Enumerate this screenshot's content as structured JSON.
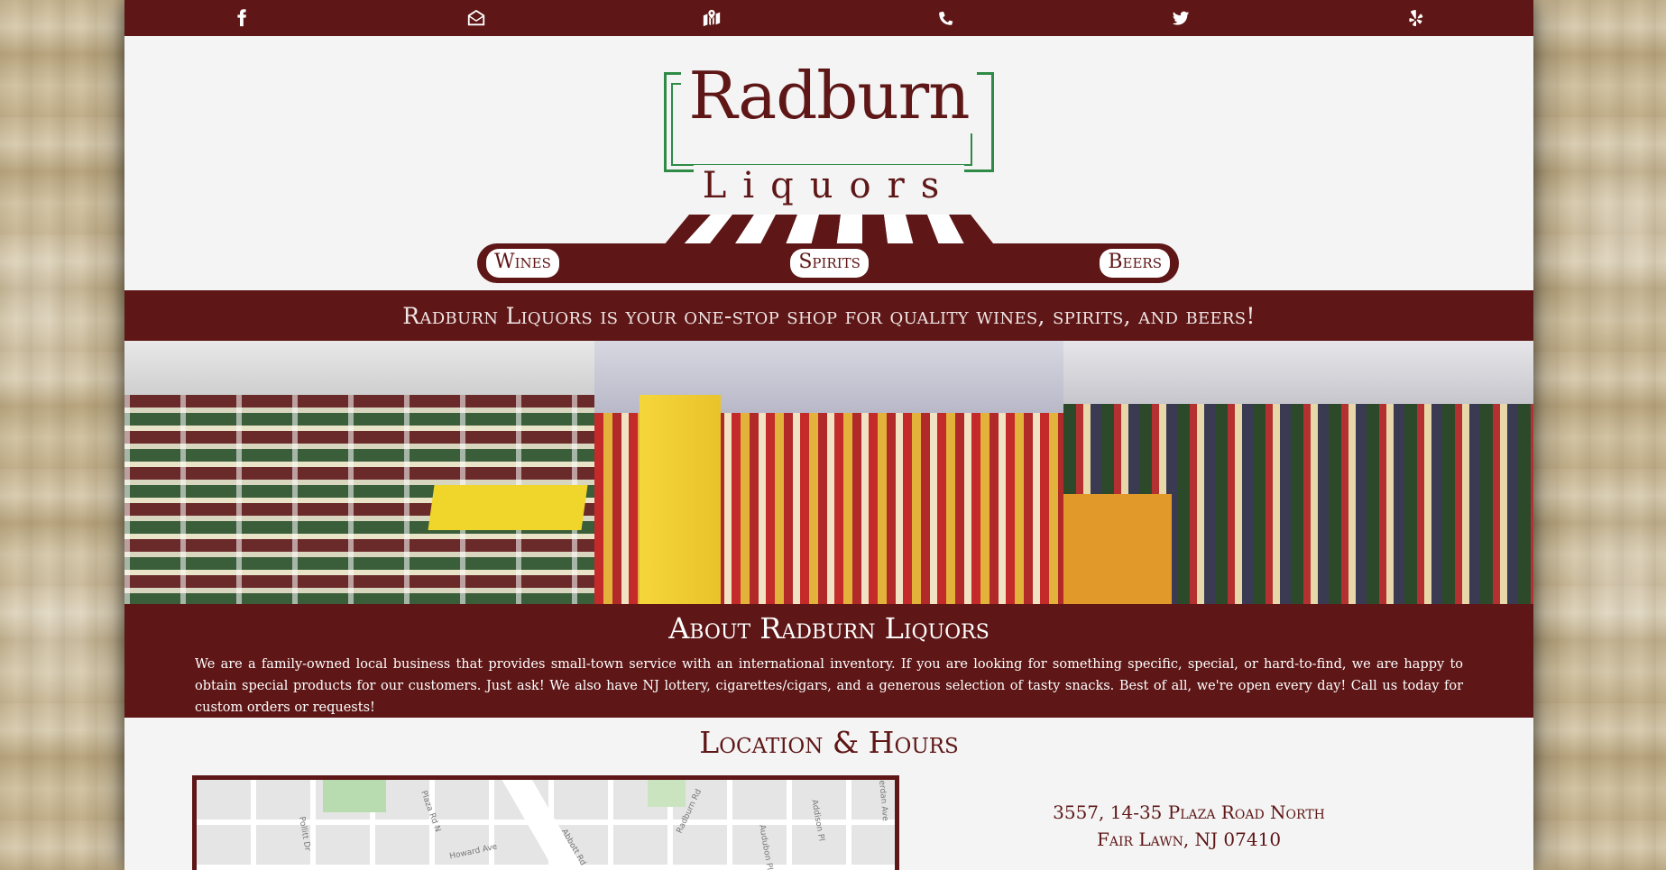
{
  "colors": {
    "brand": "#5e1616",
    "accent_green": "#2e8b46",
    "page_bg": "#f4f4f4"
  },
  "social": [
    {
      "name": "facebook-icon"
    },
    {
      "name": "email-icon"
    },
    {
      "name": "map-icon"
    },
    {
      "name": "phone-icon"
    },
    {
      "name": "twitter-icon"
    },
    {
      "name": "yelp-icon"
    }
  ],
  "logo": {
    "title": "Radburn",
    "subtitle": "Liquors"
  },
  "nav": {
    "items": [
      "Wines",
      "Spirits",
      "Beers"
    ]
  },
  "tagline": "Radburn Liquors is your one-stop shop for quality wines, spirits, and beers!",
  "about": {
    "title": "About Radburn Liquors",
    "text": "We are a family-owned local business that provides small-town service with an international inventory. If you are looking for something specific, special, or hard-to-find, we are happy to obtain special products for our customers. Just ask! We also have NJ lottery, cigarettes/cigars, and a generous selection of tasty snacks. Best of all, we're open every day! Call us today for custom orders or requests!"
  },
  "location": {
    "title": "Location & Hours",
    "address_line1": "3557, 14-35 Plaza Road North",
    "address_line2": "Fair Lawn, NJ 07410",
    "map_labels": [
      "Plaza Rd N",
      "Howard Ave",
      "Abbott Rd",
      "Radburn Rd",
      "Audubon Pl",
      "Addison Pl",
      "Pollitt Dr",
      "Berdan Ave"
    ]
  }
}
